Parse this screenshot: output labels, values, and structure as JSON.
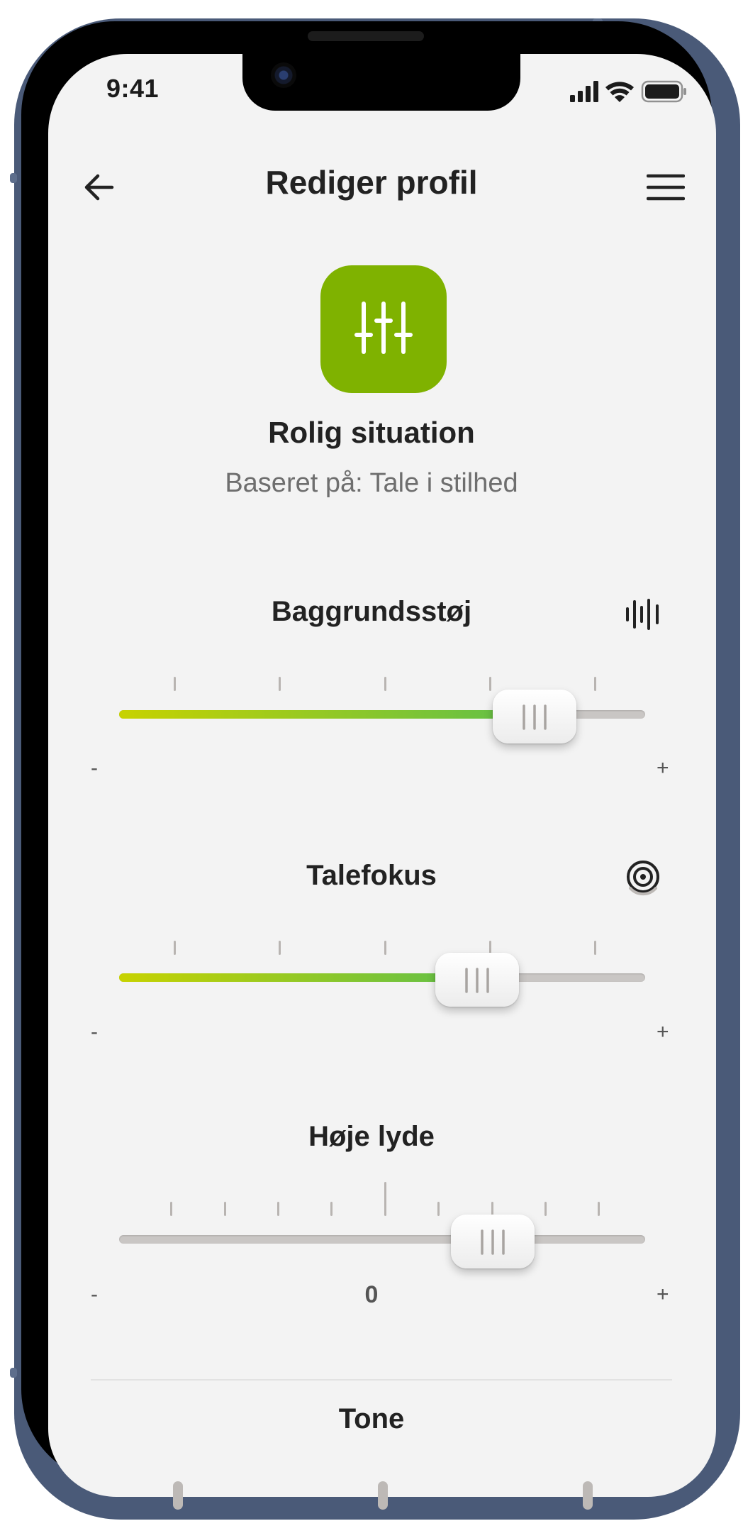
{
  "status_bar": {
    "time": "9:41"
  },
  "header": {
    "title": "Rediger profil",
    "back_icon": "arrow-left-icon",
    "menu_icon": "hamburger-menu-icon"
  },
  "profile": {
    "icon": "sliders-icon",
    "accent_color": "#7fb200",
    "name": "Rolig situation",
    "based_on": "Baseret på: Tale i stilhed"
  },
  "sliders": [
    {
      "label": "Baggrundsstøj",
      "icon": "sound-wave-icon",
      "value_fraction": 0.79,
      "min_label": "-",
      "max_label": "+"
    },
    {
      "label": "Talefokus",
      "icon": "focus-target-icon",
      "value_fraction": 0.68,
      "min_label": "-",
      "max_label": "+"
    },
    {
      "label": "Høje lyde",
      "value_fraction": 0.71,
      "min_label": "-",
      "center_label": "0",
      "max_label": "+"
    }
  ],
  "tone": {
    "label": "Tone"
  },
  "colors": {
    "gradient_start": "#c7d200",
    "gradient_end": "#5fbf4a",
    "background": "#f3f3f3"
  }
}
